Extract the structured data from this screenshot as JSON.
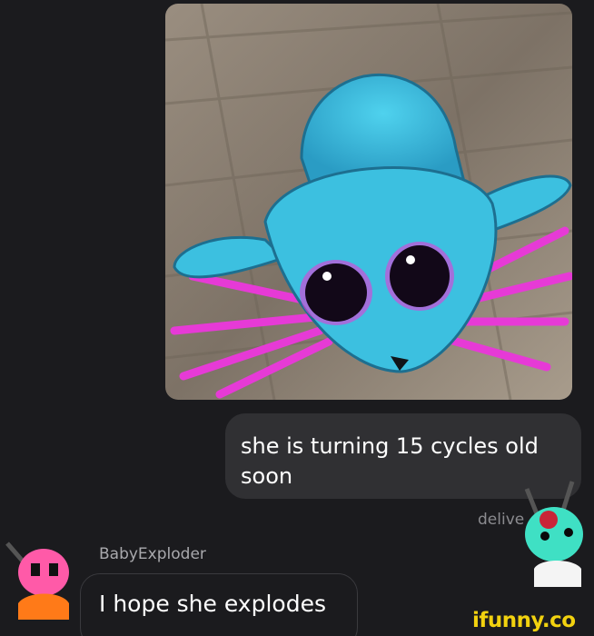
{
  "messages": {
    "sent_text": "she is turning 15 cycles old soon",
    "status": "delive",
    "sender_name": "BabyExploder",
    "received_text": "I hope she explodes"
  },
  "watermark": {
    "text": "ifunny.co"
  },
  "colors": {
    "background": "#1b1b1e",
    "sent_bubble": "#303033",
    "creature_blue": "#36b8d8",
    "gills_magenta": "#e63ad6",
    "watermark": "#f2d20f"
  }
}
